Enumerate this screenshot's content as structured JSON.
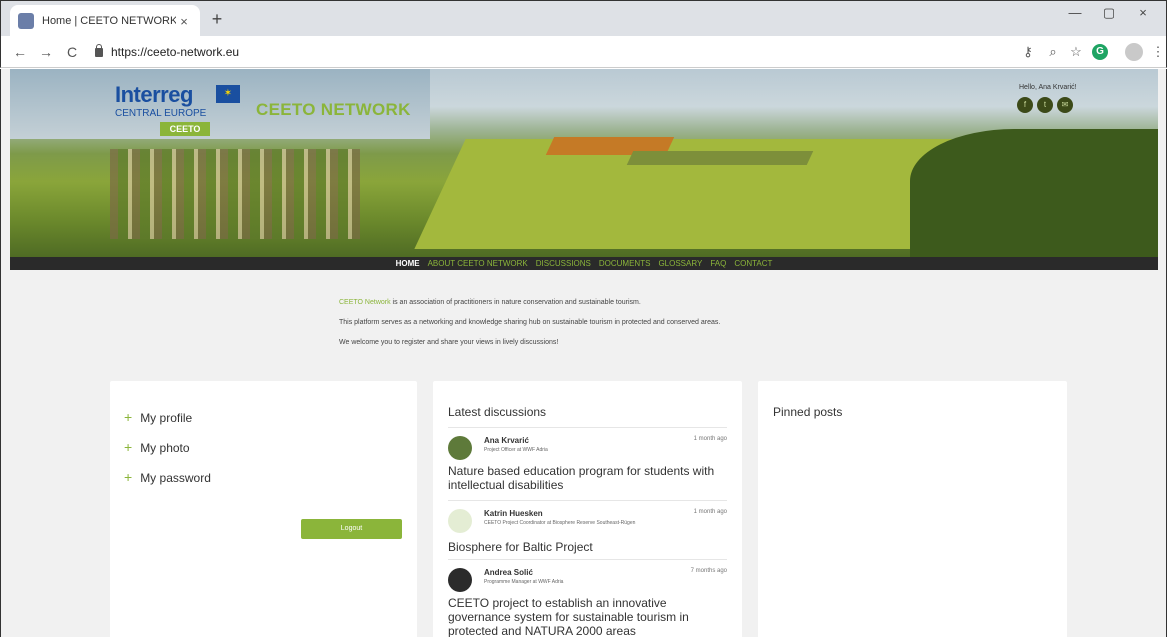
{
  "browser": {
    "tab_title": "Home | CEETO NETWORK",
    "tab_close": "×",
    "new_tab": "+",
    "url": "https://ceeto-network.eu",
    "back": "←",
    "forward": "→",
    "reload": "C",
    "minimize": "—",
    "maximize": "▢",
    "close": "×"
  },
  "header": {
    "logo_text": "Interreg",
    "logo_region": "CENTRAL EUROPE",
    "logo_tag": "CEETO",
    "site_name": "CEETO NETWORK",
    "greeting": "Hello, Ana Krvarić!",
    "social": [
      "f",
      "t",
      "✉"
    ]
  },
  "nav": {
    "items": [
      "HOME",
      "ABOUT CEETO NETWORK",
      "DISCUSSIONS",
      "DOCUMENTS",
      "GLOSSARY",
      "FAQ",
      "CONTACT"
    ]
  },
  "intro": {
    "brand": "CEETO Network",
    "line1_rest": " is an association of practitioners in nature conservation and sustainable tourism.",
    "line2": "This platform serves as a networking and knowledge sharing hub on sustainable tourism in protected and conserved areas.",
    "line3": "We welcome you to register and share your views in lively discussions!"
  },
  "profile_menu": {
    "items": [
      "My profile",
      "My photo",
      "My password"
    ],
    "logout": "Logout"
  },
  "latest": {
    "title": "Latest discussions",
    "items": [
      {
        "author": "Ana Krvarić",
        "role": "Project Officer at WWF Adria",
        "time": "1 month ago",
        "title": "Nature based education program for students with intellectual disabilities"
      },
      {
        "author": "Katrin Huesken",
        "role": "CEETO Project Coordinator at Biosphere Reserve Southeast-Rügen",
        "time": "1 month ago",
        "title": "Biosphere for Baltic Project"
      },
      {
        "author": "Andrea Solić",
        "role": "Programme Manager at WWF Adria",
        "time": "7 months ago",
        "title": "CEETO project to establish an innovative governance system for sustainable tourism in protected and NATURA 2000 areas"
      }
    ]
  },
  "pinned": {
    "title": "Pinned posts"
  },
  "colors": {
    "accent": "#8bb53a",
    "nav_bg": "#2a2a2a",
    "page_bg": "#f1f1f1"
  }
}
